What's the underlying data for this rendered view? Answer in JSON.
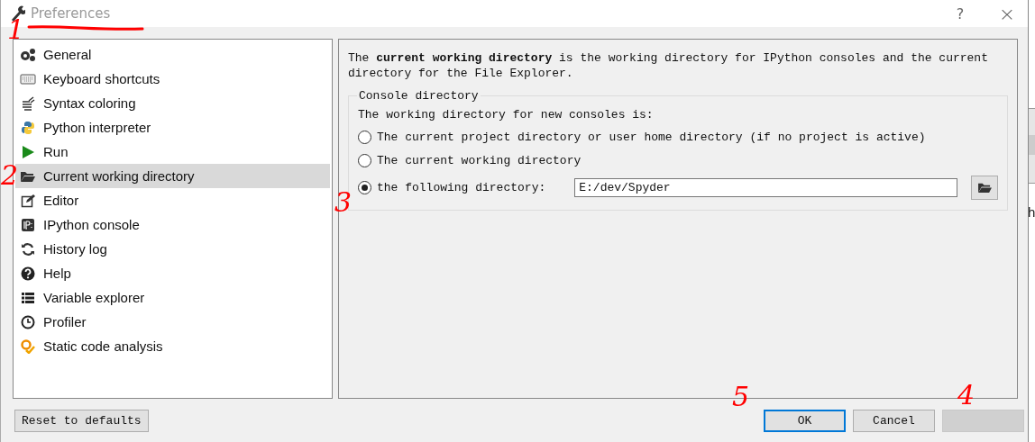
{
  "window": {
    "title": "Preferences",
    "help": "?",
    "close": "×"
  },
  "pages": [
    {
      "label": "General",
      "selected": false
    },
    {
      "label": "Keyboard shortcuts",
      "selected": false
    },
    {
      "label": "Syntax coloring",
      "selected": false
    },
    {
      "label": "Python interpreter",
      "selected": false
    },
    {
      "label": "Run",
      "selected": false
    },
    {
      "label": "Current working directory",
      "selected": true
    },
    {
      "label": "Editor",
      "selected": false
    },
    {
      "label": "IPython console",
      "selected": false
    },
    {
      "label": "History log",
      "selected": false
    },
    {
      "label": "Help",
      "selected": false
    },
    {
      "label": "Variable explorer",
      "selected": false
    },
    {
      "label": "Profiler",
      "selected": false
    },
    {
      "label": "Static code analysis",
      "selected": false
    }
  ],
  "panel": {
    "description": "The **current working directory** is the working directory for IPython consoles and the current directory for the File Explorer.",
    "group": {
      "title": "Console directory",
      "prompt": "The working directory for new consoles is:",
      "options": [
        {
          "label": "The current project directory or user home directory (if no project is active)",
          "selected": false
        },
        {
          "label": "The current working directory",
          "selected": false
        },
        {
          "label": "the following directory:",
          "selected": true
        }
      ],
      "path": {
        "value": "E:/dev/Spyder"
      }
    }
  },
  "footer": {
    "reset": "Reset to defaults",
    "buttons": [
      {
        "label": "OK",
        "default": true
      },
      {
        "label": "Cancel",
        "default": false
      }
    ]
  },
  "background_app": {
    "text": "h"
  },
  "annotations": [
    {
      "label": "1"
    },
    {
      "label": "2"
    },
    {
      "label": "3"
    },
    {
      "label": "5"
    },
    {
      "label": "4"
    }
  ]
}
